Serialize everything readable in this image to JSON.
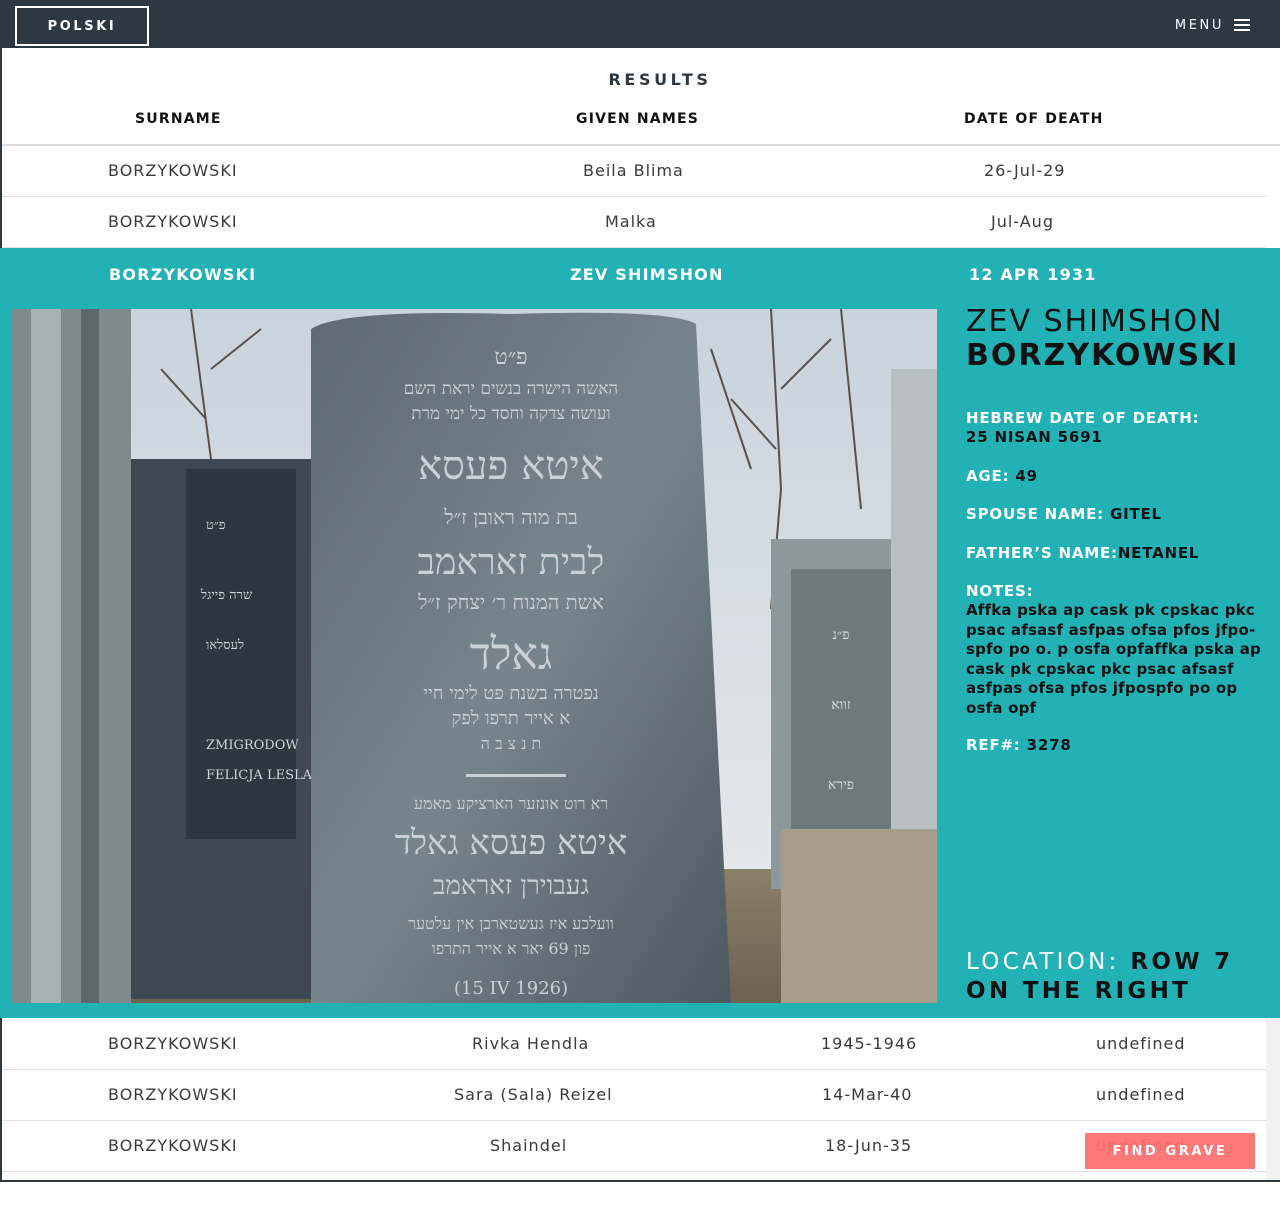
{
  "header": {
    "language_button": "POLSKI",
    "menu_label": "MENU",
    "menu_icon": "hamburger-icon"
  },
  "results": {
    "title": "RESULTS",
    "columns": [
      "SURNAME",
      "GIVEN NAMES",
      "DATE OF DEATH"
    ],
    "rows_above": [
      {
        "surname": "BORZYKOWSKI",
        "given": "Beila Blima",
        "date": "26-Jul-29"
      },
      {
        "surname": "BORZYKOWSKI",
        "given": "Malka",
        "date": "Jul-Aug"
      }
    ],
    "selected": {
      "surname": "BORZYKOWSKI",
      "given": "ZEV SHIMSHON",
      "date": "12 APR 1931"
    },
    "rows_below": [
      {
        "surname": "BORZYKOWSKI",
        "given": "Rivka Hendla",
        "date": "1945-1946",
        "extra": "undefined"
      },
      {
        "surname": "BORZYKOWSKI",
        "given": "Sara (Sala) Reizel",
        "date": "14-Mar-40",
        "extra": "undefined"
      },
      {
        "surname": "BORZYKOWSKI",
        "given": "Shaindel",
        "date": "18-Jun-35",
        "extra": "undefined"
      }
    ]
  },
  "detail": {
    "first_name": "ZEV SHIMSHON",
    "last_name": "BORZYKOWSKI",
    "hebrew_date_label": "HEBREW DATE OF DEATH:",
    "hebrew_date_value": "25 NISAN 5691",
    "age_label": "AGE:",
    "age_value": "49",
    "spouse_label": "SPOUSE NAME:",
    "spouse_value": "GITEL",
    "father_label": "FATHER’S NAME:",
    "father_value": "NETANEL",
    "notes_label": "NOTES:",
    "notes_value": "Affka pska ap cask pk cpskac pkc psac afsasf asfpas ofsa pfos jfpo-spfo po o. p osfa opfaffka pska ap cask pk cpskac pkc  psac afsasf asfpas ofsa pfos jfpospfo po op osfa opf",
    "ref_label": "REF#:",
    "ref_value": "3278",
    "location_label": "LOCATION:",
    "location_value": "ROW 7 ON THE RIGHT"
  },
  "find_grave_button": "FIND GRAVE"
}
